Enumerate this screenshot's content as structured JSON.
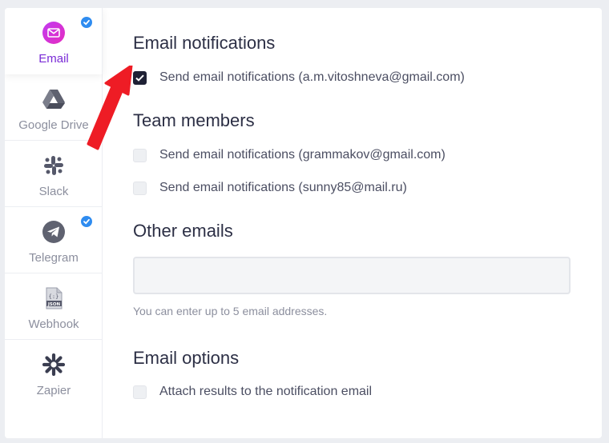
{
  "sidebar": {
    "items": [
      {
        "label": "Email",
        "icon": "envelope-icon",
        "active": true,
        "badge": true
      },
      {
        "label": "Google Drive",
        "icon": "google-drive-icon",
        "active": false,
        "badge": false
      },
      {
        "label": "Slack",
        "icon": "slack-icon",
        "active": false,
        "badge": false
      },
      {
        "label": "Telegram",
        "icon": "telegram-icon",
        "active": false,
        "badge": true
      },
      {
        "label": "Webhook",
        "icon": "json-file-icon",
        "active": false,
        "badge": false,
        "icon_text": "JSON"
      },
      {
        "label": "Zapier",
        "icon": "zapier-icon",
        "active": false,
        "badge": false
      }
    ]
  },
  "email_notifications": {
    "title": "Email notifications",
    "option": {
      "label": "Send email notifications (a.m.vitoshneva@gmail.com)",
      "checked": true
    }
  },
  "team_members": {
    "title": "Team members",
    "options": [
      {
        "label": "Send email notifications (grammakov@gmail.com)",
        "checked": false
      },
      {
        "label": "Send email notifications (sunny85@mail.ru)",
        "checked": false
      }
    ]
  },
  "other_emails": {
    "title": "Other emails",
    "value": "",
    "placeholder": "",
    "hint": "You can enter up to 5 email addresses."
  },
  "email_options": {
    "title": "Email options",
    "option": {
      "label": "Attach results to the notification email",
      "checked": false
    }
  },
  "colors": {
    "accent_purple": "#7a2bd6",
    "badge_blue": "#2f8cf0",
    "arrow_red": "#ee1c25",
    "checkbox_checked": "#1f2135"
  }
}
